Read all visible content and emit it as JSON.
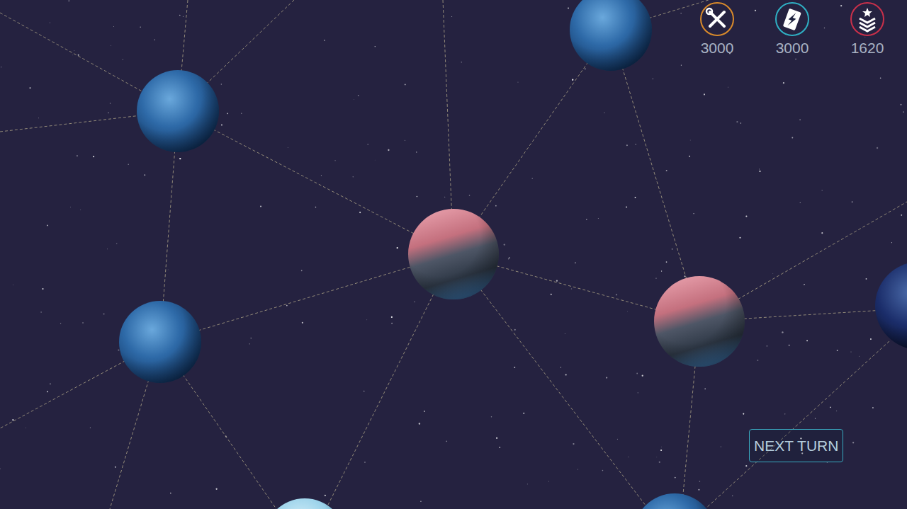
{
  "resources": [
    {
      "value": "3000",
      "color": "#d98a2b"
    },
    {
      "value": "3000",
      "color": "#2fb0c4"
    },
    {
      "value": "1620",
      "color": "#c9304a"
    }
  ],
  "planets": [
    {
      "kind": "blue"
    },
    {
      "kind": "blue"
    },
    {
      "kind": "red"
    },
    {
      "kind": "red"
    },
    {
      "kind": "blue"
    },
    {
      "kind": "dark"
    },
    {
      "kind": "pale"
    },
    {
      "kind": "blue"
    }
  ],
  "next_turn_button": "NEXT TURN"
}
